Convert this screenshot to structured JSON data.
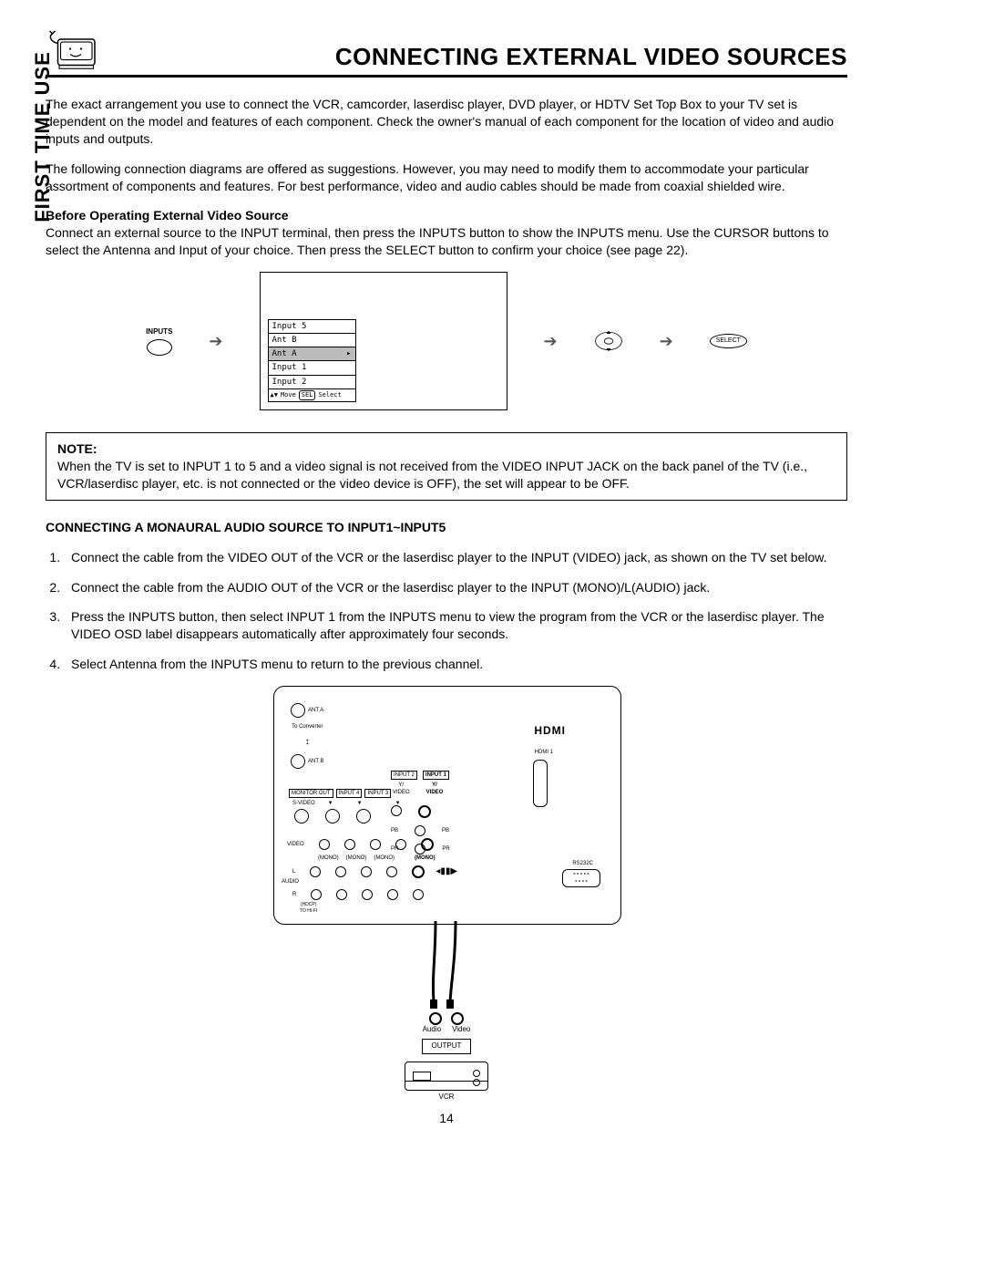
{
  "page_title": "CONNECTING EXTERNAL VIDEO SOURCES",
  "side_label": "FIRST TIME USE",
  "intro1": "The exact arrangement you use to connect the VCR, camcorder, laserdisc player, DVD player, or HDTV Set Top Box to your TV set is dependent on the model and features of each component.  Check the owner's manual of each component for the location of video and audio inputs and outputs.",
  "intro2": "The following connection diagrams are offered as suggestions.  However, you may need to modify them to accommodate your particular assortment of components and features.  For best performance, video and audio cables should be made from coaxial shielded wire.",
  "before_heading": "Before Operating External Video Source",
  "before_text": "Connect an external source to the INPUT terminal, then press the INPUTS button to show the INPUTS menu.  Use the CURSOR buttons to select the Antenna and Input of your choice.  Then press the SELECT button to confirm your choice (see page 22).",
  "inputs_button_label": "INPUTS",
  "menu": {
    "items": [
      "Input 5",
      "Ant B",
      "Ant A",
      "Input 1",
      "Input 2"
    ],
    "selected_index": 2,
    "footer_move": "Move",
    "footer_sel_btn": "SEL",
    "footer_select": "Select"
  },
  "select_label": "SELECT",
  "note": {
    "label": "NOTE:",
    "text": "When the TV is set to INPUT 1 to 5 and a video signal is not received from the VIDEO INPUT JACK on the back panel of the TV (i.e., VCR/laserdisc player, etc. is not connected or the video device is OFF), the set will appear to be OFF."
  },
  "mono_heading": "CONNECTING A MONAURAL AUDIO SOURCE TO INPUT1~INPUT5",
  "steps": [
    "Connect the cable from the VIDEO OUT of the VCR or the laserdisc player to the INPUT (VIDEO) jack, as shown on the TV set below.",
    "Connect the cable from the AUDIO OUT of the VCR or the laserdisc player to the INPUT (MONO)/L(AUDIO) jack.",
    "Press the INPUTS button, then select INPUT 1 from the INPUTS menu to view the program from the VCR or the laserdisc player.  The VIDEO OSD label disappears automatically after approximately four seconds.",
    "Select Antenna from the INPUTS menu to return to the previous channel."
  ],
  "rear": {
    "ant_a": "ANT A",
    "to_converter": "To Converter",
    "ant_b": "ANT B",
    "hdmi_logo": "HDMI",
    "hdmi1": "HDMI 1",
    "headers": {
      "monitor_out": "MONITOR OUT",
      "input4": "INPUT 4",
      "input3": "INPUT 3",
      "input2": "INPUT 2",
      "input1": "INPUT 1"
    },
    "svideo": "S-VIDEO",
    "video_row": "VIDEO",
    "audio_row": "AUDIO",
    "l": "L",
    "r": "R",
    "mono": "(MONO)",
    "y_video_a": "Y/\nVIDEO",
    "y_video_b": "Y/\nVIDEO",
    "pb": "PB",
    "pr": "PR",
    "under_r": "(HDCP)\nTO HI-FI",
    "rs232": "RS232C",
    "audio_out": "Audio",
    "video_out": "Video",
    "output": "OUTPUT",
    "vcr": "VCR"
  },
  "page_number": "14"
}
